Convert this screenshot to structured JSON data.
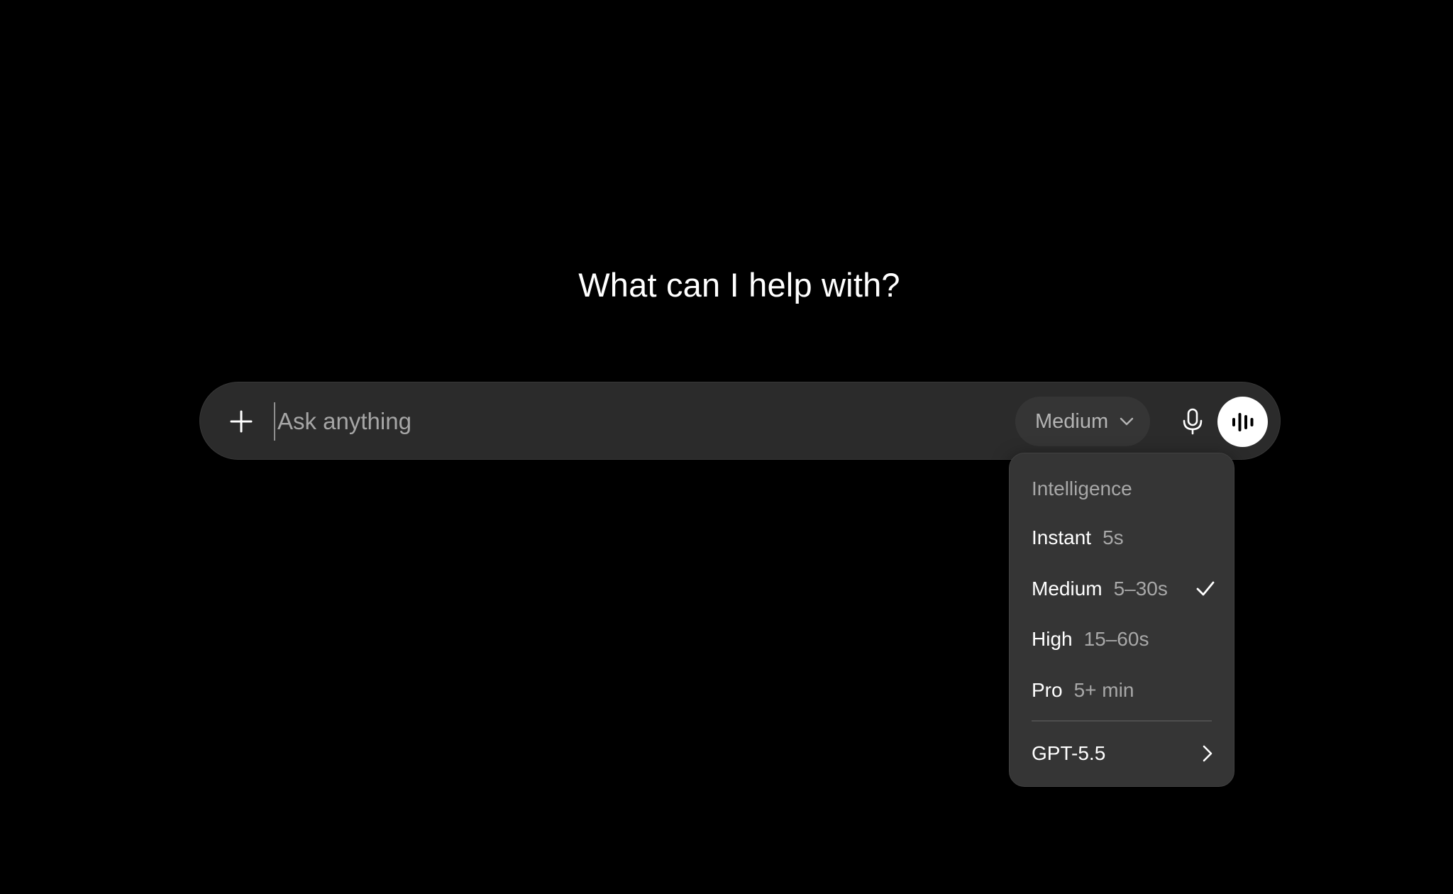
{
  "heading": "What can I help with?",
  "composer": {
    "placeholder": "Ask anything",
    "mode_label": "Medium",
    "icons": {
      "attach": "plus-icon",
      "mode": "chevron-down-icon",
      "dictate": "microphone-icon",
      "voice": "voice-waveform-icon"
    }
  },
  "menu": {
    "header": "Intelligence",
    "items": [
      {
        "name": "Instant",
        "time": "5s",
        "selected": false
      },
      {
        "name": "Medium",
        "time": "5–30s",
        "selected": true
      },
      {
        "name": "High",
        "time": "15–60s",
        "selected": false
      },
      {
        "name": "Pro",
        "time": "5+ min",
        "selected": false
      }
    ],
    "model": {
      "label": "GPT-5.5",
      "icon": "chevron-right-icon"
    }
  },
  "colors": {
    "background": "#000000",
    "composer": "#2b2b2b",
    "menu": "#353535",
    "secondary_text": "#a8a8a8"
  }
}
